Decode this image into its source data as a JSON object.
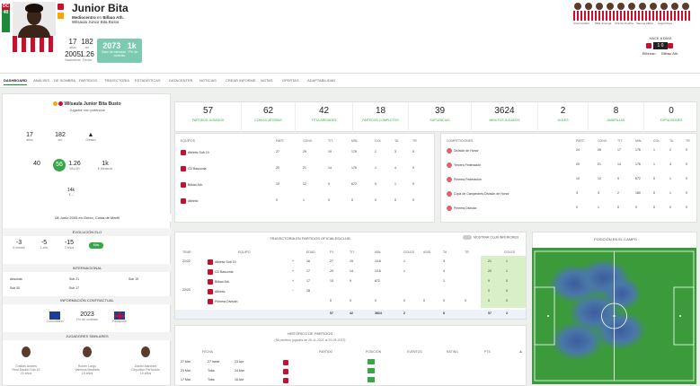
{
  "player": {
    "rating": "40",
    "position": "DC",
    "name": "Junior Bita",
    "role": "Mediocentro",
    "club_connector": "en",
    "club": "Bilbao Ath.",
    "full_name": "Wilsaula Junior Bita Busto",
    "height": "17",
    "height_label": "años",
    "weight": "182",
    "weight_label": "cm",
    "value": "2073",
    "value_label": "Valor de mercado",
    "bonus": "1k",
    "bonus_label": "Fin de contrato",
    "year": "2005",
    "year_label": "Nacimiento",
    "sub_val": "1.26",
    "sub_label": "Fecha"
  },
  "teammates": [
    "Chemiohelba",
    "Milla Jimenga",
    "Chimbo Pedrita",
    "Samuel Alfara",
    "Ángel Pérez"
  ],
  "match": {
    "date": "HACE 6 DÍAS",
    "score": "1 0",
    "home": "Ellbrean",
    "away": "Bilbao Ath."
  },
  "tabs": [
    "Dashboard",
    "Análisis",
    "De Sombra",
    "Partidos",
    "Trayectoria",
    "Estadísticas",
    "Datacenter",
    "Noticias",
    "Crear Informe",
    "Notas",
    "Ofertas",
    "Adaptabilidad"
  ],
  "card": {
    "name": "Wilsaula Junior Bita Busto",
    "subtitle": "Jugador con potencial",
    "age": "17",
    "age_label": "años",
    "height": "182",
    "height_label": "cm",
    "foot_label": "Diestro",
    "cur": "40",
    "pot": "56",
    "pot_label": "POT",
    "val1": "1.26",
    "val1_label": "VALOR",
    "val2": "1k",
    "val2_label": "€ Mensual",
    "mini": "14k",
    "mini_label": "€ –",
    "birth": "08 Junio 2005 en Getxo, Costa de Marfil",
    "sec_evol": "EVOLUCIÓN ELO",
    "evol": [
      [
        "-3",
        "6 meses"
      ],
      [
        "-5",
        "1 año"
      ],
      [
        "-15",
        "2 años"
      ]
    ],
    "evol_btn": "Más",
    "sec_intl": "INTERNACIONAL",
    "intl": [
      "Absoluta",
      "Sub 21",
      "Sub 19",
      "Sub 20",
      "Sub 17"
    ],
    "sec_contract": "INFORMACIÓN CONTRACTUAL",
    "contract_year": "2023",
    "contract_a": "Comunitario",
    "contract_b": "Fin de contrato",
    "contract_c": "Pasaporte",
    "sec_compare": "JUGADORES SIMILARES",
    "compare": [
      [
        "Cristian Andrés",
        "Real Madrid Sub 19",
        "22 años"
      ],
      [
        "Rubén Largo",
        "Valencia Mestalla",
        "19 años"
      ],
      [
        "Daniel Martínez",
        "Deportivo Perforado",
        "19 años"
      ]
    ]
  },
  "summary": [
    [
      "57",
      "Partidos jugados"
    ],
    [
      "62",
      "Convocatorias"
    ],
    [
      "42",
      "Titularidades"
    ],
    [
      "18",
      "Partidos completos"
    ],
    [
      "39",
      "Suplencias"
    ],
    [
      "3624",
      "Minutos jugados"
    ],
    [
      "2",
      "Goles"
    ],
    [
      "8",
      "Amarillas"
    ],
    [
      "0",
      "Expulsiones"
    ]
  ],
  "teams": {
    "headers": [
      "Equipos",
      "Part.",
      "Conv.",
      "Tit.",
      "Min.",
      "Gol",
      "TA",
      "TR"
    ],
    "rows": [
      [
        "Athletic Sub 19",
        "27",
        "29",
        "19",
        "176",
        "1",
        "3",
        "0"
      ],
      [
        "CD Basconia",
        "20",
        "21",
        "14",
        "176",
        "1",
        "4",
        "0"
      ],
      [
        "Bilbao Ath.",
        "10",
        "12",
        "9",
        "672",
        "0",
        "1",
        "0"
      ],
      [
        "Athletic",
        "0",
        "1",
        "0",
        "0",
        "0",
        "0",
        "0"
      ]
    ]
  },
  "comps": {
    "headers": [
      "Competiciones",
      "Part.",
      "Conv.",
      "Tit.",
      "Min.",
      "Gol",
      "TA",
      "TR"
    ],
    "rows": [
      [
        "División de Honor",
        "24",
        "26",
        "17",
        "176",
        "1",
        "2",
        "0"
      ],
      [
        "Tercera Federación",
        "20",
        "21",
        "14",
        "176",
        "1",
        "4",
        "0"
      ],
      [
        "Primera Federación",
        "10",
        "12",
        "9",
        "672",
        "0",
        "1",
        "0"
      ],
      [
        "Copa de Campeones División de Honor",
        "3",
        "3",
        "2",
        "180",
        "0",
        "1",
        "0"
      ],
      [
        "Primera División",
        "0",
        "1",
        "0",
        "0",
        "0",
        "0",
        "0"
      ]
    ]
  },
  "trajectory": {
    "title": "TRAYECTORIA EN PARTIDOS OFICIALES/CLUB",
    "toggle": "MOSTRAR CLUB INFERIORES",
    "headers": [
      "Temp.",
      "Equipo",
      "Edad",
      "PJ",
      "Tit.",
      "Min.",
      "Goles",
      "Asis",
      "TA",
      "TR",
      "Goles"
    ],
    "seasons": [
      "21/22",
      "22/23"
    ],
    "rows": [
      [
        "Athletic Sub 19",
        "+",
        "16",
        "27",
        "19",
        "1/16",
        "1",
        "",
        "3",
        "",
        "21",
        "1"
      ],
      [
        "CD Basconia",
        "+",
        "17",
        "20",
        "14",
        "1/16",
        "1",
        "",
        "4",
        "",
        "20",
        "1"
      ],
      [
        "Bilbao Ath.",
        "+",
        "17",
        "10",
        "9",
        "672",
        "",
        "",
        "1",
        "",
        "9",
        "0"
      ],
      [
        "Athletic",
        "−",
        "18",
        "",
        "",
        "",
        "",
        "",
        "",
        "",
        "0",
        "0"
      ],
      [
        "Primera División",
        "",
        "",
        "0",
        "0",
        "0",
        "0",
        "0",
        "0",
        "0",
        "0",
        "0"
      ]
    ],
    "total": [
      "57",
      "42",
      "3624",
      "2",
      "",
      "8",
      "",
      "57",
      "2"
    ]
  },
  "history": {
    "title": "HISTÓRICO DE PARTIDOS",
    "subtitle": "(56 partidos jugados de 29-11-2021 al 29-05-2023)",
    "headers": [
      "Fecha",
      "Partido",
      "Posición",
      "Eventos",
      "Rating",
      "PTS"
    ],
    "rows": [
      [
        "27 Mar",
        "27 Inese",
        "23 Apr"
      ],
      [
        "23 Mar",
        "Toba",
        "24 Mar"
      ],
      [
        "17 Mar",
        "Toba",
        "16 Abr"
      ]
    ]
  },
  "heatmap": {
    "title": "POSICIÓN EN EL CAMPO"
  }
}
